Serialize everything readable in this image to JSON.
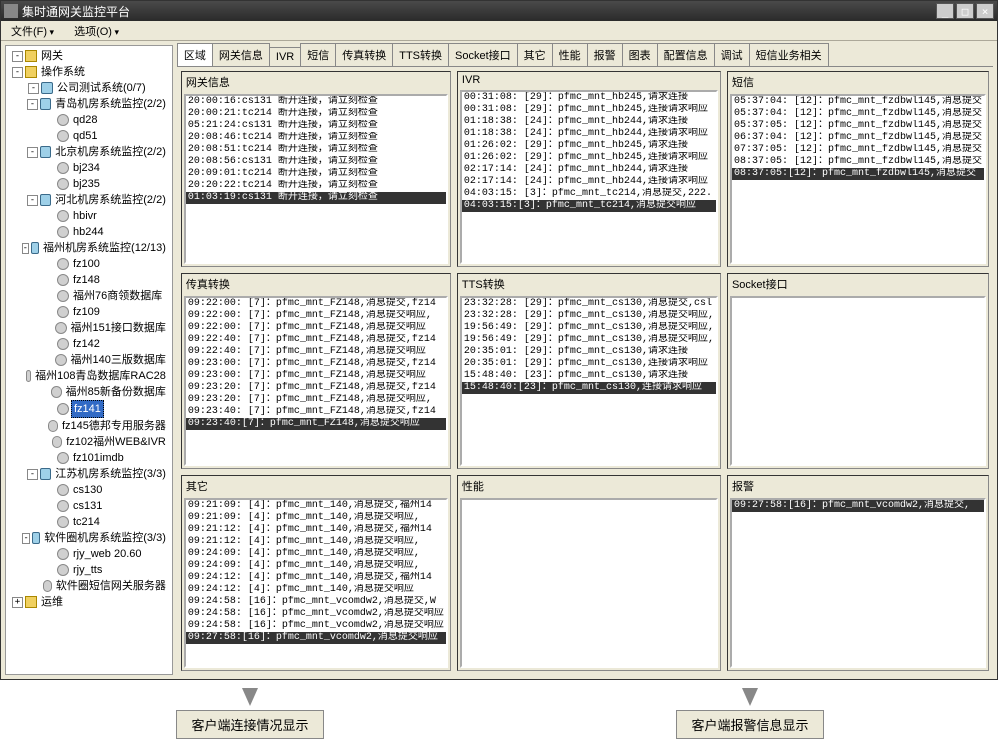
{
  "window": {
    "title": "集时通网关监控平台",
    "buttons": {
      "min": "_",
      "max": "□",
      "close": "×"
    }
  },
  "menu": {
    "file": "文件(F)",
    "options": "选项(O)"
  },
  "tree": {
    "items": [
      {
        "depth": 0,
        "exp": "-",
        "icon": "folder",
        "label": "网关"
      },
      {
        "depth": 0,
        "exp": "-",
        "icon": "folder",
        "label": "操作系统"
      },
      {
        "depth": 1,
        "exp": "-",
        "icon": "server",
        "label": "公司测试系统(0/7)"
      },
      {
        "depth": 1,
        "exp": "-",
        "icon": "server",
        "label": "青岛机房系统监控(2/2)"
      },
      {
        "depth": 2,
        "exp": " ",
        "icon": "node",
        "label": "qd28"
      },
      {
        "depth": 2,
        "exp": " ",
        "icon": "node",
        "label": "qd51"
      },
      {
        "depth": 1,
        "exp": "-",
        "icon": "server",
        "label": "北京机房系统监控(2/2)"
      },
      {
        "depth": 2,
        "exp": " ",
        "icon": "node",
        "label": "bj234"
      },
      {
        "depth": 2,
        "exp": " ",
        "icon": "node",
        "label": "bj235"
      },
      {
        "depth": 1,
        "exp": "-",
        "icon": "server",
        "label": "河北机房系统监控(2/2)"
      },
      {
        "depth": 2,
        "exp": " ",
        "icon": "node",
        "label": "hbivr"
      },
      {
        "depth": 2,
        "exp": " ",
        "icon": "node",
        "label": "hb244"
      },
      {
        "depth": 1,
        "exp": "-",
        "icon": "server",
        "label": "福州机房系统监控(12/13)"
      },
      {
        "depth": 2,
        "exp": " ",
        "icon": "node",
        "label": "fz100"
      },
      {
        "depth": 2,
        "exp": " ",
        "icon": "node",
        "label": "fz148"
      },
      {
        "depth": 2,
        "exp": " ",
        "icon": "node",
        "label": "福州76商领数据库"
      },
      {
        "depth": 2,
        "exp": " ",
        "icon": "node",
        "label": "fz109"
      },
      {
        "depth": 2,
        "exp": " ",
        "icon": "node",
        "label": "福州151接口数据库"
      },
      {
        "depth": 2,
        "exp": " ",
        "icon": "node",
        "label": "fz142"
      },
      {
        "depth": 2,
        "exp": " ",
        "icon": "node",
        "label": "福州140三版数据库"
      },
      {
        "depth": 2,
        "exp": " ",
        "icon": "node",
        "label": "福州108青岛数据库RAC28"
      },
      {
        "depth": 2,
        "exp": " ",
        "icon": "node",
        "label": "福州85新备份数据库"
      },
      {
        "depth": 2,
        "exp": " ",
        "icon": "node",
        "label": "fz141",
        "sel": true
      },
      {
        "depth": 2,
        "exp": " ",
        "icon": "node",
        "label": "fz145德邦专用服务器"
      },
      {
        "depth": 2,
        "exp": " ",
        "icon": "node",
        "label": "fz102福州WEB&IVR"
      },
      {
        "depth": 2,
        "exp": " ",
        "icon": "node",
        "label": "fz101imdb"
      },
      {
        "depth": 1,
        "exp": "-",
        "icon": "server",
        "label": "江苏机房系统监控(3/3)"
      },
      {
        "depth": 2,
        "exp": " ",
        "icon": "node",
        "label": "cs130"
      },
      {
        "depth": 2,
        "exp": " ",
        "icon": "node",
        "label": "cs131"
      },
      {
        "depth": 2,
        "exp": " ",
        "icon": "node",
        "label": "tc214"
      },
      {
        "depth": 1,
        "exp": "-",
        "icon": "server",
        "label": "软件圈机房系统监控(3/3)"
      },
      {
        "depth": 2,
        "exp": " ",
        "icon": "node",
        "label": "rjy_web 20.60"
      },
      {
        "depth": 2,
        "exp": " ",
        "icon": "node",
        "label": "rjy_tts"
      },
      {
        "depth": 2,
        "exp": " ",
        "icon": "node",
        "label": "软件圈短信网关服务器"
      },
      {
        "depth": 0,
        "exp": "+",
        "icon": "folder",
        "label": "运维"
      }
    ]
  },
  "tabs": [
    "区域",
    "网关信息",
    "IVR",
    "短信",
    "传真转换",
    "TTS转换",
    "Socket接口",
    "其它",
    "性能",
    "报警",
    "图表",
    "配置信息",
    "调试",
    "短信业务相关"
  ],
  "panels": [
    {
      "title": "网关信息",
      "lines": [
        {
          "t": "20:00:16:cs131 断开连接，请立刻检查"
        },
        {
          "t": "20:00:21:tc214 断开连接，请立刻检查"
        },
        {
          "t": "05:21:24:cs131 断开连接，请立刻检查"
        },
        {
          "t": "20:08:46:tc214 断开连接，请立刻检查"
        },
        {
          "t": "20:08:51:tc214 断开连接，请立刻检查"
        },
        {
          "t": "20:08:56:cs131 断开连接，请立刻检查"
        },
        {
          "t": "20:09:01:tc214 断开连接，请立刻检查"
        },
        {
          "t": "20:20:22:tc214 断开连接，请立刻检查"
        },
        {
          "t": "01:03:19:cs131 断开连接，请立刻检查",
          "sel": true
        }
      ]
    },
    {
      "title": "IVR",
      "lines": [
        {
          "t": "00:31:08: [29]：pfmc_mnt_hb245,请求连接"
        },
        {
          "t": "00:31:08: [29]：pfmc_mnt_hb245,连接请求响应"
        },
        {
          "t": "01:18:38: [24]：pfmc_mnt_hb244,请求连接"
        },
        {
          "t": "01:18:38: [24]：pfmc_mnt_hb244,连接请求响应"
        },
        {
          "t": "01:26:02: [29]：pfmc_mnt_hb245,请求连接"
        },
        {
          "t": "01:26:02: [29]：pfmc_mnt_hb245,连接请求响应"
        },
        {
          "t": "02:17:14: [24]：pfmc_mnt_hb244,请求连接"
        },
        {
          "t": "02:17:14: [24]：pfmc_mnt_hb244,连接请求响应"
        },
        {
          "t": "04:03:15: [3]：pfmc_mnt_tc214,消息提交,222."
        },
        {
          "t": "04:03:15:[3]：pfmc_mnt_tc214,消息提交响应",
          "sel": true
        }
      ]
    },
    {
      "title": "短信",
      "lines": [
        {
          "t": "05:37:04: [12]：pfmc_mnt_fzdbwl145,消息提交"
        },
        {
          "t": "05:37:04: [12]：pfmc_mnt_fzdbwl145,消息提交"
        },
        {
          "t": "05:37:05: [12]：pfmc_mnt_fzdbwl145,消息提交"
        },
        {
          "t": "06:37:04: [12]：pfmc_mnt_fzdbwl145,消息提交"
        },
        {
          "t": "07:37:05: [12]：pfmc_mnt_fzdbwl145,消息提交"
        },
        {
          "t": "08:37:05: [12]：pfmc_mnt_fzdbwl145,消息提交"
        },
        {
          "t": "08:37:05:[12]：pfmc_mnt_fzdbwl145,消息提交",
          "sel": true
        }
      ]
    },
    {
      "title": "传真转换",
      "lines": [
        {
          "t": "09:22:00: [7]：pfmc_mnt_FZ148,消息提交,fz14"
        },
        {
          "t": "09:22:00: [7]：pfmc_mnt_FZ148,消息提交响应,"
        },
        {
          "t": "09:22:00: [7]：pfmc_mnt_FZ148,消息提交响应"
        },
        {
          "t": "09:22:40: [7]：pfmc_mnt_FZ148,消息提交,fz14"
        },
        {
          "t": "09:22:40: [7]：pfmc_mnt_FZ148,消息提交响应"
        },
        {
          "t": "09:23:00: [7]：pfmc_mnt_FZ148,消息提交,fz14"
        },
        {
          "t": "09:23:00: [7]：pfmc_mnt_FZ148,消息提交响应"
        },
        {
          "t": "09:23:20: [7]：pfmc_mnt_FZ148,消息提交,fz14"
        },
        {
          "t": "09:23:20: [7]：pfmc_mnt_FZ148,消息提交响应,"
        },
        {
          "t": "09:23:40: [7]：pfmc_mnt_FZ148,消息提交,fz14"
        },
        {
          "t": "09:23:40:[7]：pfmc_mnt_FZ148,消息提交响应",
          "sel": true
        }
      ]
    },
    {
      "title": "TTS转换",
      "lines": [
        {
          "t": "23:32:28: [29]：pfmc_mnt_cs130,消息提交,csl"
        },
        {
          "t": "23:32:28: [29]：pfmc_mnt_cs130,消息提交响应,"
        },
        {
          "t": "19:56:49: [29]：pfmc_mnt_cs130,消息提交响应,"
        },
        {
          "t": "19:56:49: [29]：pfmc_mnt_cs130,消息提交响应,"
        },
        {
          "t": "20:35:01: [29]：pfmc_mnt_cs130,请求连接"
        },
        {
          "t": "20:35:01: [29]：pfmc_mnt_cs130,连接请求响应"
        },
        {
          "t": "15:48:40: [23]：pfmc_mnt_cs130,请求连接"
        },
        {
          "t": "15:48:40:[23]：pfmc_mnt_cs130,连接请求响应",
          "sel": true
        }
      ]
    },
    {
      "title": "Socket接口",
      "lines": []
    },
    {
      "title": "其它",
      "lines": [
        {
          "t": "09:21:09: [4]：pfmc_mnt_140,消息提交,福州14"
        },
        {
          "t": "09:21:09: [4]：pfmc_mnt_140,消息提交响应,"
        },
        {
          "t": "09:21:12: [4]：pfmc_mnt_140,消息提交,福州14"
        },
        {
          "t": "09:21:12: [4]：pfmc_mnt_140,消息提交响应,"
        },
        {
          "t": "09:24:09: [4]：pfmc_mnt_140,消息提交响应,"
        },
        {
          "t": "09:24:09: [4]：pfmc_mnt_140,消息提交响应,"
        },
        {
          "t": "09:24:12: [4]：pfmc_mnt_140,消息提交,福州14"
        },
        {
          "t": "09:24:12: [4]：pfmc_mnt_140,消息提交响应"
        },
        {
          "t": "09:24:58: [16]：pfmc_mnt_vcomdw2,消息提交,W"
        },
        {
          "t": "09:24:58: [16]：pfmc_mnt_vcomdw2,消息提交响应"
        },
        {
          "t": "09:24:58: [16]：pfmc_mnt_vcomdw2,消息提交响应"
        },
        {
          "t": "09:27:58:[16]：pfmc_mnt_vcomdw2,消息提交响应",
          "sel": true
        }
      ]
    },
    {
      "title": "性能",
      "lines": []
    },
    {
      "title": "报警",
      "lines": [
        {
          "t": "09:27:58:[16]：pfmc_mnt_vcomdw2,消息提交,",
          "sel": true
        }
      ]
    }
  ],
  "callouts": {
    "left": "客户端连接情况显示",
    "right": "客户端报警信息显示"
  }
}
